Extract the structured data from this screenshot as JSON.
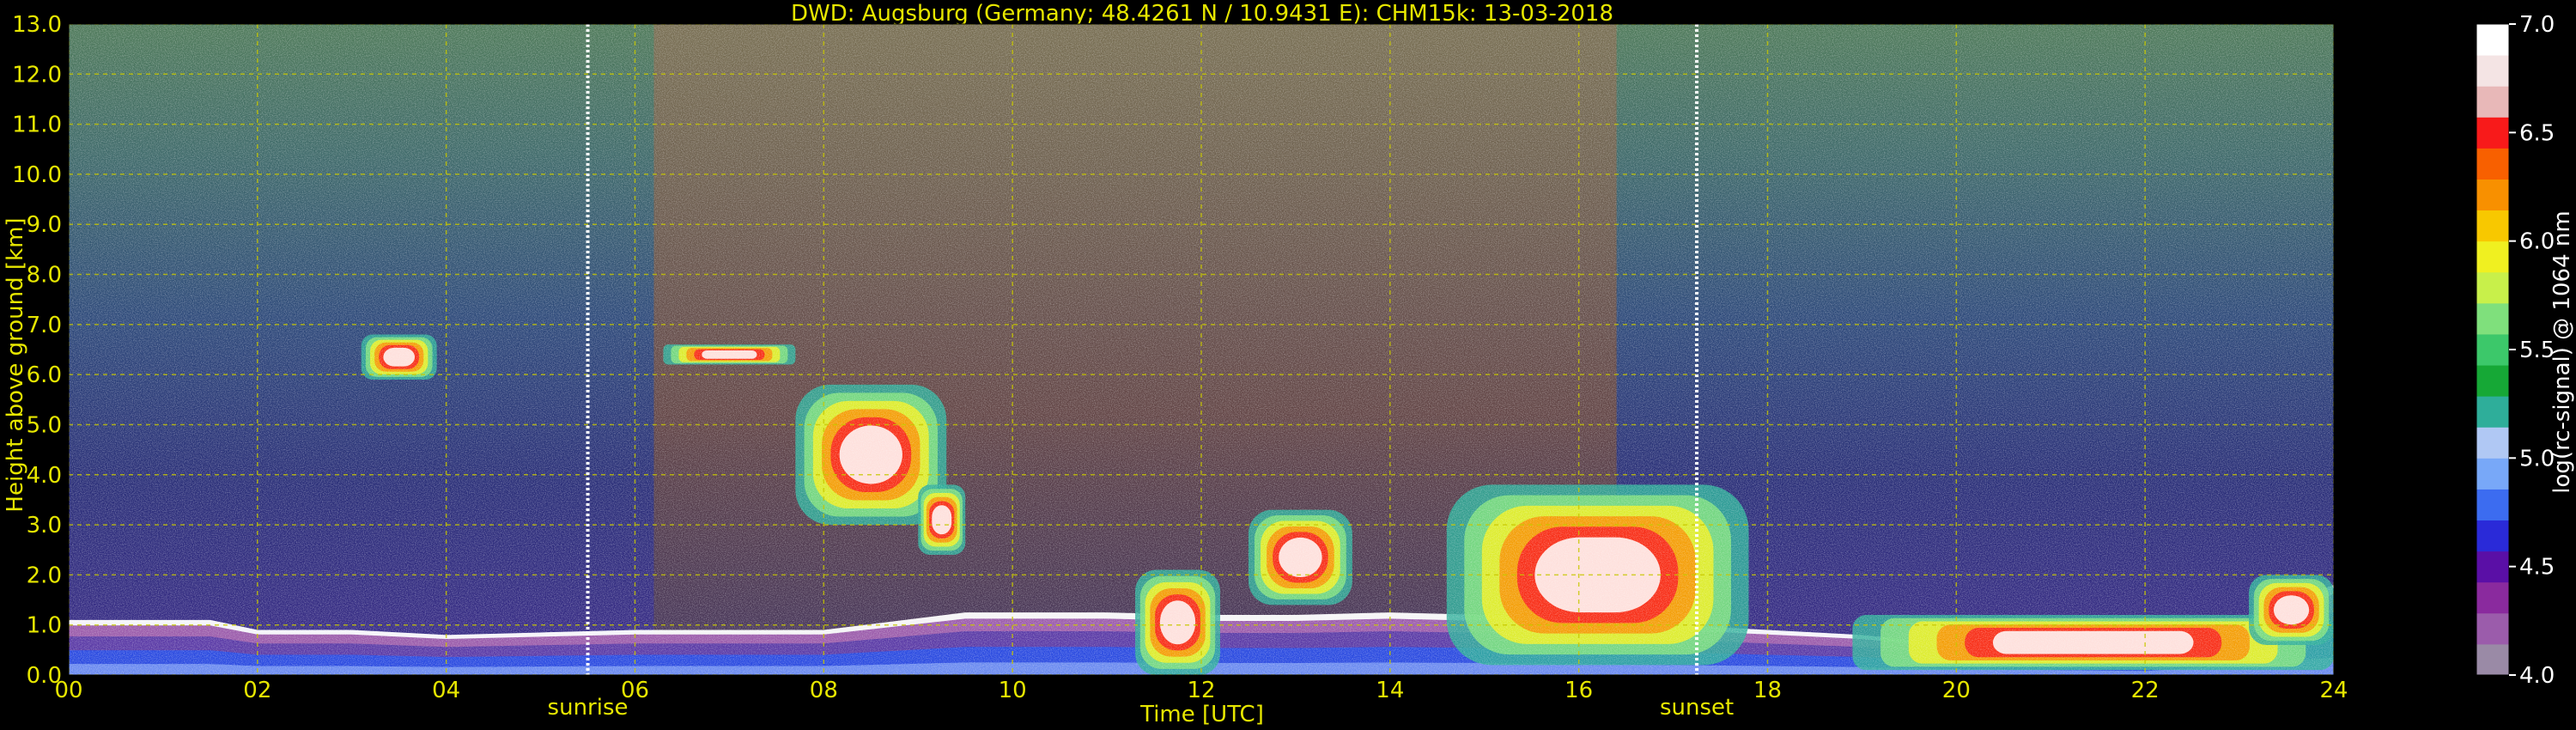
{
  "chart_data": {
    "type": "heatmap",
    "title": "DWD: Augsburg (Germany; 48.4261 N / 10.9431 E):    CHM15k: 13-03-2018",
    "xlabel": "Time [UTC]",
    "ylabel": "Height above ground [km]",
    "colorbar_label": "log(rc-signal) @ 1064 nm",
    "xlim": [
      0,
      24
    ],
    "ylim": [
      0,
      13
    ],
    "x_ticks": [
      "00",
      "02",
      "04",
      "06",
      "08",
      "10",
      "12",
      "14",
      "16",
      "18",
      "20",
      "22",
      "24"
    ],
    "y_ticks": [
      "0.0",
      "1.0",
      "2.0",
      "3.0",
      "4.0",
      "5.0",
      "6.0",
      "7.0",
      "8.0",
      "9.0",
      "10.0",
      "11.0",
      "12.0",
      "13.0"
    ],
    "colorbar_range": [
      4.0,
      7.0
    ],
    "colorbar_ticks": [
      "4.0",
      "4.5",
      "5.0",
      "5.5",
      "6.0",
      "6.5",
      "7.0"
    ],
    "grid": true,
    "vertical_markers": [
      {
        "label": "sunrise",
        "x": 5.5
      },
      {
        "label": "sunset",
        "x": 17.25
      }
    ],
    "colormap": [
      "#9a8aa6",
      "#9b5cab",
      "#8a2a9e",
      "#5a0fa6",
      "#2a2ad8",
      "#3c6cf0",
      "#78a8f8",
      "#b0c8f4",
      "#2eae9a",
      "#16a836",
      "#3cc86a",
      "#7fe07c",
      "#c8f04a",
      "#f0f020",
      "#f8c800",
      "#f89000",
      "#f86000",
      "#f81a1a",
      "#e8b8b8",
      "#f4e4e4",
      "#ffffff"
    ],
    "signal_layers": [
      {
        "feature": "boundary layer aerosol top",
        "x": [
          0,
          1.5,
          2,
          3,
          4,
          5,
          6,
          8,
          9.5,
          11,
          12,
          13,
          14,
          15,
          17,
          18,
          19,
          20,
          21,
          22,
          23,
          24
        ],
        "top_km": [
          1.1,
          1.1,
          0.9,
          0.9,
          0.8,
          0.85,
          0.9,
          0.9,
          1.25,
          1.25,
          1.2,
          1.2,
          1.25,
          1.2,
          1.0,
          0.9,
          0.8,
          0.6,
          0.5,
          0.4,
          1.0,
          1.8
        ]
      },
      {
        "feature": "cloud",
        "x_range": [
          3.1,
          3.9
        ],
        "height_km": [
          5.9,
          6.8
        ]
      },
      {
        "feature": "cloud",
        "x_range": [
          6.3,
          7.7
        ],
        "height_km": [
          6.2,
          6.6
        ]
      },
      {
        "feature": "cloud",
        "x_range": [
          7.7,
          9.3
        ],
        "height_km": [
          3.0,
          5.8
        ]
      },
      {
        "feature": "cloud",
        "x_range": [
          9.0,
          9.5
        ],
        "height_km": [
          2.4,
          3.8
        ]
      },
      {
        "feature": "precipitation / low cloud",
        "x_range": [
          11.3,
          12.2
        ],
        "height_km": [
          0.0,
          2.1
        ]
      },
      {
        "feature": "cloud",
        "x_range": [
          12.5,
          13.6
        ],
        "height_km": [
          1.4,
          3.3
        ]
      },
      {
        "feature": "low cloud",
        "x_range": [
          14.6,
          17.8
        ],
        "height_km": [
          0.2,
          3.8
        ]
      },
      {
        "feature": "aerosol",
        "x_range": [
          18.9,
          24
        ],
        "height_km": [
          0.1,
          1.2
        ]
      },
      {
        "feature": "cloud",
        "x_range": [
          23.1,
          24
        ],
        "height_km": [
          0.6,
          2.0
        ]
      }
    ]
  }
}
